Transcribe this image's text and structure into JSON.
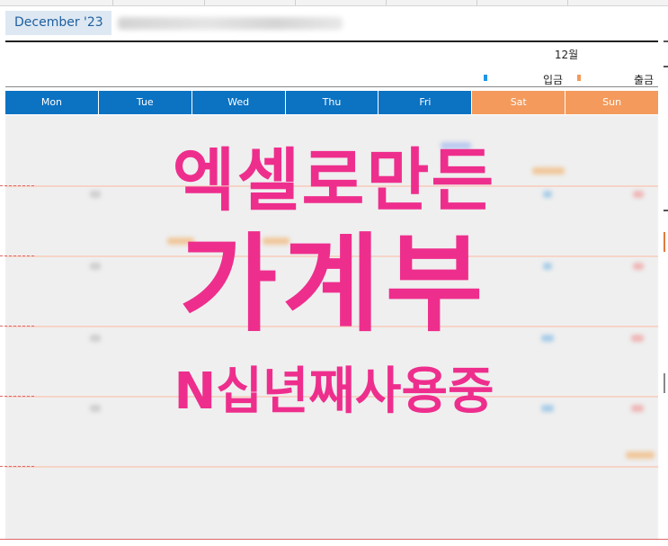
{
  "header": {
    "month_tab": "December '23"
  },
  "calendar": {
    "month_label": "12월",
    "legend": [
      {
        "label": "입금",
        "color": "#1e96e6"
      },
      {
        "label": "출금",
        "color": "#f39a5c"
      }
    ],
    "weekdays": [
      "Mon",
      "Tue",
      "Wed",
      "Thu",
      "Fri",
      "Sat",
      "Sun"
    ],
    "colors": {
      "weekday_header": "#0c72c2",
      "weekend_header": "#f39a5c"
    }
  },
  "overlay": {
    "line1": "엑셀로만든",
    "line2": "가계부",
    "line3": "N십년째사용중",
    "color": "#ee2e8d"
  }
}
